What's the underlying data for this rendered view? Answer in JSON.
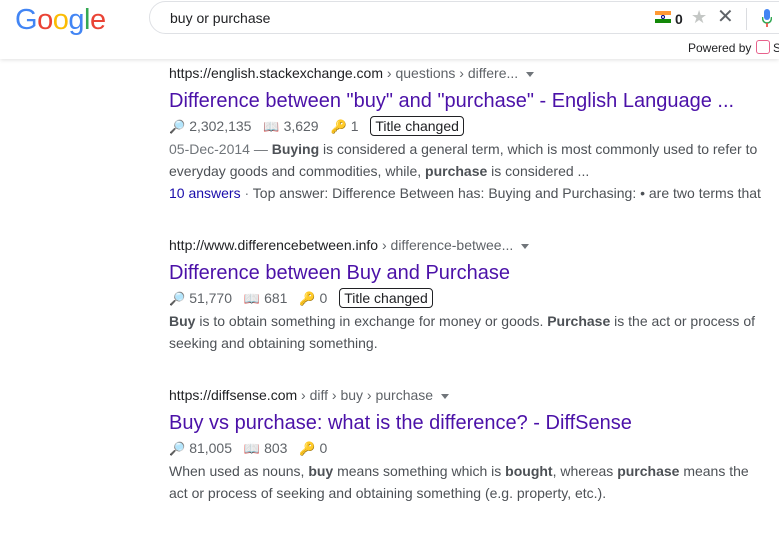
{
  "header": {
    "logo_letters": [
      {
        "ch": "G",
        "color": "#4285F4"
      },
      {
        "ch": "o",
        "color": "#EA4335"
      },
      {
        "ch": "o",
        "color": "#FBBC05"
      },
      {
        "ch": "g",
        "color": "#4285F4"
      },
      {
        "ch": "l",
        "color": "#34A853"
      },
      {
        "ch": "e",
        "color": "#EA4335"
      }
    ],
    "search_value": "buy or purchase",
    "flag_count": "0",
    "powered_by": "Powered by",
    "powered_tail": "S"
  },
  "results": [
    {
      "url": "https://english.stackexchange.com",
      "crumbs": " › questions › differe...",
      "title": "Difference between \"buy\" and \"purchase\" - English Language ...",
      "views": "2,302,135",
      "reads": "3,629",
      "keys": "1",
      "badge": "Title changed",
      "date": "05-Dec-2014 — ",
      "snippet_parts": [
        {
          "t": "Buying",
          "b": true
        },
        {
          "t": " is considered a general term, which is most commonly used to refer to everyday goods and commodities, while, ",
          "b": false
        },
        {
          "t": "purchase",
          "b": true
        },
        {
          "t": " is considered ...",
          "b": false
        }
      ],
      "answers": "10 answers",
      "separator": " · ",
      "top_answer": "Top answer: Difference Between has: Buying and Purchasing: • are two terms that"
    },
    {
      "url": "http://www.differencebetween.info",
      "crumbs": " › difference-betwee...",
      "title": "Difference between Buy and Purchase",
      "views": "51,770",
      "reads": "681",
      "keys": "0",
      "badge": "Title changed",
      "snippet_parts": [
        {
          "t": "Buy",
          "b": true
        },
        {
          "t": " is to obtain something in exchange for money or goods. ",
          "b": false
        },
        {
          "t": "Purchase",
          "b": true
        },
        {
          "t": " is the act or process of seeking and obtaining something.",
          "b": false
        }
      ]
    },
    {
      "url": "https://diffsense.com",
      "crumbs": " › diff › buy › purchase",
      "title": "Buy vs purchase: what is the difference? - DiffSense",
      "views": "81,005",
      "reads": "803",
      "keys": "0",
      "snippet_parts": [
        {
          "t": "When used as nouns, ",
          "b": false
        },
        {
          "t": "buy",
          "b": true
        },
        {
          "t": " means something which is ",
          "b": false
        },
        {
          "t": "bought",
          "b": true
        },
        {
          "t": ", whereas ",
          "b": false
        },
        {
          "t": "purchase",
          "b": true
        },
        {
          "t": " means the act or process of seeking and obtaining something (e.g. property, etc.).",
          "b": false
        }
      ]
    }
  ],
  "icons": {
    "views": "magnifier-icon",
    "reads": "book-icon",
    "keys": "key-icon"
  }
}
